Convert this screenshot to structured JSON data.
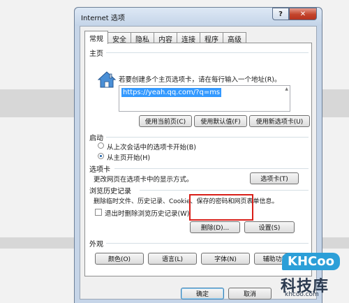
{
  "window": {
    "title": "Internet 选项",
    "help_glyph": "?",
    "close_glyph": "✕"
  },
  "tabs": [
    "常规",
    "安全",
    "隐私",
    "内容",
    "连接",
    "程序",
    "高级"
  ],
  "homepage": {
    "section_label": "主页",
    "instruction": "若要创建多个主页选项卡，请在每行输入一个地址(R)。",
    "url": "https://yeah.qq.com/?q=ms",
    "icon": "home-icon",
    "buttons": [
      "使用当前页(C)",
      "使用默认值(F)",
      "使用新选项卡(U)"
    ]
  },
  "startup": {
    "section_label": "启动",
    "options": [
      {
        "label": "从上次会话中的选项卡开始(B)",
        "selected": false
      },
      {
        "label": "从主页开始(H)",
        "selected": true
      }
    ]
  },
  "tabs_section": {
    "section_label": "选项卡",
    "description": "更改网页在选项卡中的显示方式。",
    "button": "选项卡(T)"
  },
  "history": {
    "section_label": "浏览历史记录",
    "description": "删除临时文件、历史记录、Cookie、保存的密码和网页表单信息。",
    "checkbox_label": "退出时删除浏览历史记录(W)",
    "checkbox_checked": false,
    "delete_button": "删除(D)...",
    "settings_button": "设置(S)"
  },
  "appearance": {
    "section_label": "外观",
    "buttons": [
      "颜色(O)",
      "语言(L)",
      "字体(N)",
      "辅助功能(E)"
    ]
  },
  "footer": {
    "ok": "确定",
    "cancel": "取消"
  },
  "watermark": {
    "brand": "KHCoo",
    "name_cn": "科技库",
    "url": "khcoo.com"
  },
  "colors": {
    "highlight_box": "#d91e18",
    "url_selection": "#3399ff",
    "brand_blue": "#2c9fd8"
  }
}
